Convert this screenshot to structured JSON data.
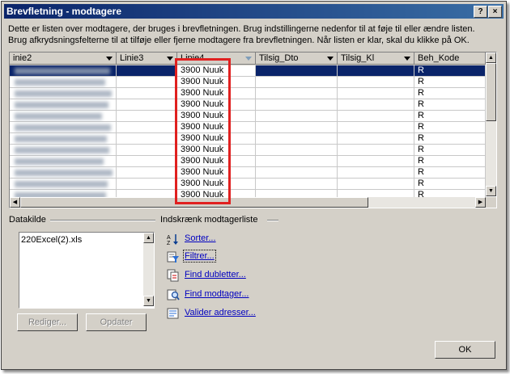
{
  "window": {
    "title": "Brevfletning - modtagere",
    "help_label": "?",
    "close_label": "×"
  },
  "description": {
    "line1": "Dette er listen over modtagere, der bruges i brevfletningen. Brug indstillingerne nedenfor til at føje til eller ændre listen.",
    "line2": "Brug afkrydsningsfelterne til at tilføje eller fjerne modtagere fra brevfletningen. Når listen er klar, skal du klikke på OK."
  },
  "grid": {
    "columns": [
      "inie2",
      "Linie3",
      "Linie4",
      "Tilsig_Dto",
      "Tilsig_Kl",
      "Beh_Kode"
    ],
    "rows": [
      [
        "",
        "",
        "3900 Nuuk",
        "",
        "",
        "R"
      ],
      [
        "",
        "",
        "3900 Nuuk",
        "",
        "",
        "R"
      ],
      [
        "",
        "",
        "3900 Nuuk",
        "",
        "",
        "R"
      ],
      [
        "",
        "",
        "3900 Nuuk",
        "",
        "",
        "R"
      ],
      [
        "",
        "",
        "3900 Nuuk",
        "",
        "",
        "R"
      ],
      [
        "",
        "",
        "3900 Nuuk",
        "",
        "",
        "R"
      ],
      [
        "",
        "",
        "3900 Nuuk",
        "",
        "",
        "R"
      ],
      [
        "",
        "",
        "3900 Nuuk",
        "",
        "",
        "R"
      ],
      [
        "",
        "",
        "3900 Nuuk",
        "",
        "",
        "R"
      ],
      [
        "",
        "",
        "3900 Nuuk",
        "",
        "",
        "R"
      ],
      [
        "",
        "",
        "3900 Nuuk",
        "",
        "",
        "R"
      ],
      [
        "",
        "",
        "3900 Nuuk",
        "",
        "",
        "R"
      ]
    ]
  },
  "datasource": {
    "label": "Datakilde",
    "items": [
      "220Excel(2).xls"
    ],
    "edit_label": "Rediger...",
    "refresh_label": "Opdater"
  },
  "refine": {
    "label": "Indskrænk modtagerliste",
    "actions": [
      {
        "label": "Sorter...",
        "icon": "sort-icon"
      },
      {
        "label": "Filtrer...",
        "icon": "filter-icon"
      },
      {
        "label": "Find dubletter...",
        "icon": "duplicates-icon"
      },
      {
        "label": "Find modtager...",
        "icon": "find-recipient-icon"
      },
      {
        "label": "Valider adresser...",
        "icon": "validate-addresses-icon"
      }
    ]
  },
  "ok_label": "OK",
  "colors": {
    "title_start": "#0a246a",
    "title_end": "#3a6ea5",
    "selection": "#0a246a",
    "highlight_box": "#e0201f",
    "link": "#0000c0",
    "face": "#d4d0c8"
  }
}
